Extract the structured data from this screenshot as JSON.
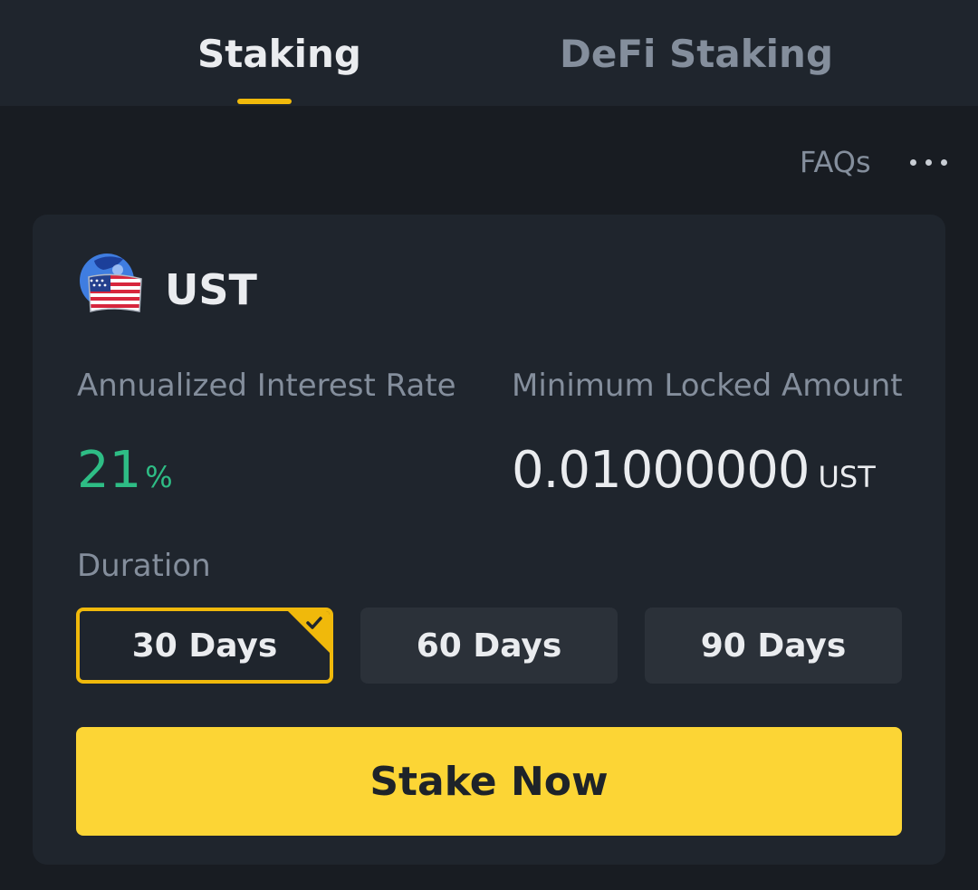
{
  "tabs": [
    {
      "label": "Staking",
      "active": true
    },
    {
      "label": "DeFi Staking",
      "active": false
    }
  ],
  "toolbar": {
    "faq_label": "FAQs",
    "more_icon": "more-horizontal-icon"
  },
  "coin": {
    "name": "UST",
    "icon": "ust-flag-globe-icon"
  },
  "apr": {
    "label": "Annualized Interest Rate",
    "value": "21",
    "unit": "%"
  },
  "min_locked": {
    "label": "Minimum Locked Amount",
    "value": "0.01000000",
    "unit": "UST"
  },
  "duration": {
    "label": "Duration",
    "options": [
      {
        "label": "30 Days",
        "selected": true
      },
      {
        "label": "60 Days",
        "selected": false
      },
      {
        "label": "90 Days",
        "selected": false
      }
    ]
  },
  "stake_button_label": "Stake Now",
  "colors": {
    "accent": "#f0b90b",
    "button": "#fcd535",
    "positive": "#2ebd85",
    "background": "#181c22",
    "card": "#1f252d"
  }
}
